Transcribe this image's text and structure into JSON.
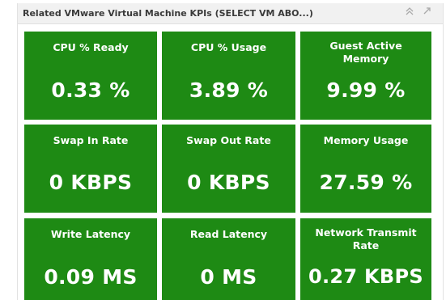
{
  "panel": {
    "title": "Related VMware Virtual Machine KPIs (SELECT VM ABO...)",
    "icons": {
      "collapse": "double-chevron-up-icon",
      "popout": "pop-out-icon"
    }
  },
  "colors": {
    "tile_background": "#1e8a14",
    "tile_text": "#ffffff",
    "header_background": "#f1f1f1"
  },
  "kpis": [
    {
      "label": "CPU % Ready",
      "value": "0.33 %"
    },
    {
      "label": "CPU % Usage",
      "value": "3.89 %"
    },
    {
      "label": "Guest Active Memory",
      "value": "9.99 %"
    },
    {
      "label": "Swap In Rate",
      "value": "0 KBPS"
    },
    {
      "label": "Swap Out Rate",
      "value": "0 KBPS"
    },
    {
      "label": "Memory Usage",
      "value": "27.59 %"
    },
    {
      "label": "Write Latency",
      "value": "0.09 MS"
    },
    {
      "label": "Read Latency",
      "value": "0 MS"
    },
    {
      "label": "Network Transmit Rate",
      "value": "0.27 KBPS"
    }
  ]
}
